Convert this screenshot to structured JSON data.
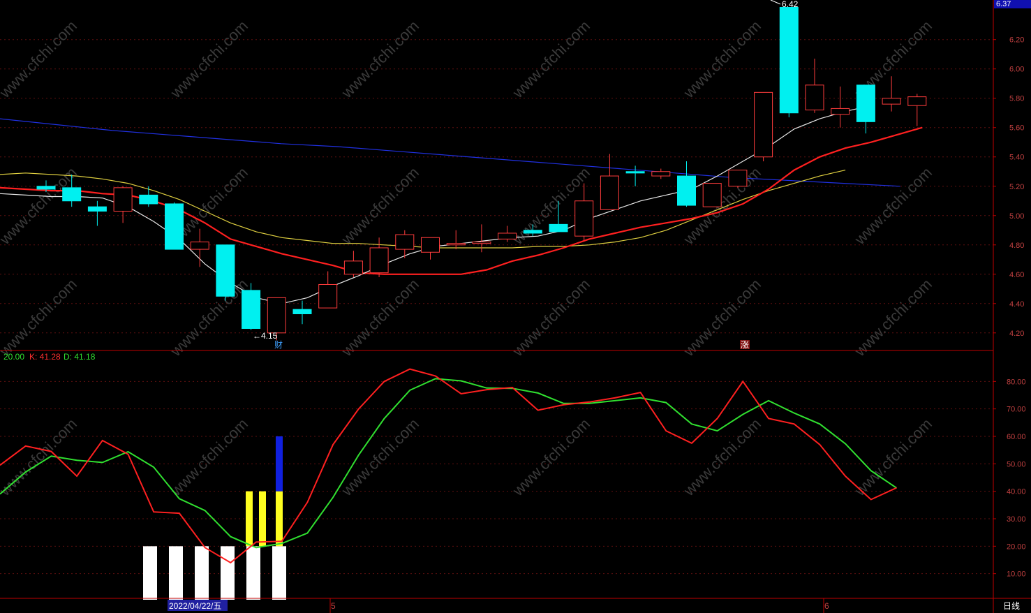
{
  "colors": {
    "background": "#000000",
    "up": "#ff3c3c",
    "down": "#00f0f0",
    "ma5": "#e8e8e8",
    "ma10": "#ff2020",
    "ma20": "#e0d040",
    "ma60": "#2030e0",
    "k_line": "#ff2020",
    "d_line": "#30e030",
    "axis": "#c00000"
  },
  "price_panel": {
    "top_label": "6.37",
    "y_ticks": [
      "6.20",
      "6.00",
      "5.80",
      "5.60",
      "5.40",
      "5.20",
      "5.00",
      "4.80",
      "4.60",
      "4.40",
      "4.20"
    ],
    "high_marker": "6.42",
    "low_marker": "←4.15",
    "event_markers": [
      "财",
      "涨"
    ]
  },
  "indicator_panel": {
    "header_prefix": "20.00",
    "k_label": "K: 41.28",
    "d_label": "D: 41.18",
    "y_ticks": [
      "80.00",
      "70.00",
      "60.00",
      "50.00",
      "40.00",
      "30.00",
      "20.00",
      "10.00"
    ]
  },
  "x_axis": {
    "date_label": "2022/04/22/五",
    "month_labels": [
      "5",
      "6"
    ],
    "period_label": "日线"
  },
  "watermark": "www.cfchi.com",
  "chart_data": {
    "type": "candlestick",
    "candles": [
      {
        "o": 5.2,
        "h": 5.24,
        "l": 5.16,
        "c": 5.18
      },
      {
        "o": 5.19,
        "h": 5.28,
        "l": 5.06,
        "c": 5.1
      },
      {
        "o": 5.06,
        "h": 5.1,
        "l": 4.93,
        "c": 5.03
      },
      {
        "o": 5.03,
        "h": 5.2,
        "l": 4.95,
        "c": 5.19
      },
      {
        "o": 5.14,
        "h": 5.2,
        "l": 5.06,
        "c": 5.08
      },
      {
        "o": 5.08,
        "h": 5.09,
        "l": 4.77,
        "c": 4.77
      },
      {
        "o": 4.77,
        "h": 4.91,
        "l": 4.65,
        "c": 4.82
      },
      {
        "o": 4.8,
        "h": 4.8,
        "l": 4.42,
        "c": 4.45
      },
      {
        "o": 4.49,
        "h": 4.54,
        "l": 4.22,
        "c": 4.23
      },
      {
        "o": 4.2,
        "h": 4.44,
        "l": 4.15,
        "c": 4.44
      },
      {
        "o": 4.36,
        "h": 4.42,
        "l": 4.26,
        "c": 4.33
      },
      {
        "o": 4.37,
        "h": 4.62,
        "l": 4.37,
        "c": 4.53
      },
      {
        "o": 4.6,
        "h": 4.76,
        "l": 4.58,
        "c": 4.69
      },
      {
        "o": 4.61,
        "h": 4.85,
        "l": 4.58,
        "c": 4.78
      },
      {
        "o": 4.77,
        "h": 4.9,
        "l": 4.71,
        "c": 4.87
      },
      {
        "o": 4.75,
        "h": 4.84,
        "l": 4.7,
        "c": 4.85
      },
      {
        "o": 4.8,
        "h": 4.9,
        "l": 4.77,
        "c": 4.81
      },
      {
        "o": 4.81,
        "h": 4.94,
        "l": 4.75,
        "c": 4.82
      },
      {
        "o": 4.84,
        "h": 4.93,
        "l": 4.82,
        "c": 4.88
      },
      {
        "o": 4.9,
        "h": 4.94,
        "l": 4.86,
        "c": 4.88
      },
      {
        "o": 4.94,
        "h": 5.1,
        "l": 4.92,
        "c": 4.89
      },
      {
        "o": 4.86,
        "h": 5.22,
        "l": 4.83,
        "c": 5.1
      },
      {
        "o": 5.04,
        "h": 5.42,
        "l": 5.04,
        "c": 5.27
      },
      {
        "o": 5.3,
        "h": 5.34,
        "l": 5.2,
        "c": 5.29
      },
      {
        "o": 5.27,
        "h": 5.32,
        "l": 5.25,
        "c": 5.3
      },
      {
        "o": 5.27,
        "h": 5.37,
        "l": 5.06,
        "c": 5.07
      },
      {
        "o": 5.06,
        "h": 5.22,
        "l": 5.06,
        "c": 5.22
      },
      {
        "o": 5.2,
        "h": 5.31,
        "l": 5.19,
        "c": 5.31
      },
      {
        "o": 5.4,
        "h": 5.83,
        "l": 5.37,
        "c": 5.84
      },
      {
        "o": 6.42,
        "h": 6.42,
        "l": 5.67,
        "c": 5.7
      },
      {
        "o": 5.72,
        "h": 6.07,
        "l": 5.7,
        "c": 5.89
      },
      {
        "o": 5.69,
        "h": 5.88,
        "l": 5.6,
        "c": 5.73
      },
      {
        "o": 5.89,
        "h": 5.89,
        "l": 5.56,
        "c": 5.64
      },
      {
        "o": 5.76,
        "h": 5.95,
        "l": 5.71,
        "c": 5.8
      },
      {
        "o": 5.75,
        "h": 5.83,
        "l": 5.61,
        "c": 5.81
      }
    ],
    "ma5": [
      5.15,
      5.14,
      5.13,
      5.13,
      5.12,
      5.06,
      4.96,
      4.84,
      4.67,
      4.54,
      4.44,
      4.4,
      4.44,
      4.52,
      4.59,
      4.67,
      4.74,
      4.79,
      4.81,
      4.83,
      4.85,
      4.86,
      4.9,
      4.98,
      5.04,
      5.1,
      5.14,
      5.18,
      5.27,
      5.37,
      5.47,
      5.59,
      5.66,
      5.71,
      5.75
    ],
    "ma10": [
      5.19,
      5.18,
      5.17,
      5.17,
      5.15,
      5.14,
      5.1,
      5.04,
      4.95,
      4.84,
      4.79,
      4.74,
      4.7,
      4.66,
      4.61,
      4.6,
      4.6,
      4.6,
      4.6,
      4.63,
      4.69,
      4.73,
      4.78,
      4.84,
      4.88,
      4.92,
      4.95,
      4.98,
      5.02,
      5.08,
      5.18,
      5.31,
      5.4,
      5.46,
      5.5,
      5.55,
      5.6
    ],
    "ma20": [
      5.28,
      5.29,
      5.28,
      5.27,
      5.25,
      5.22,
      5.17,
      5.11,
      5.03,
      4.95,
      4.89,
      4.85,
      4.83,
      4.81,
      4.81,
      4.8,
      4.79,
      4.78,
      4.78,
      4.78,
      4.78,
      4.79,
      4.79,
      4.8,
      4.82,
      4.85,
      4.9,
      4.97,
      5.04,
      5.11,
      5.17,
      5.22,
      5.27,
      5.31
    ],
    "ma60": [
      5.66,
      5.62,
      5.58,
      5.55,
      5.52,
      5.49,
      5.47,
      5.44,
      5.41,
      5.38,
      5.35,
      5.32,
      5.29,
      5.26,
      5.24,
      5.22,
      5.2
    ],
    "kdj": {
      "k": [
        49.5,
        56.5,
        54.5,
        45.5,
        58.5,
        53.5,
        32.5,
        32.0,
        19.5,
        14.0,
        21.5,
        21.8,
        36.0,
        57.0,
        70.0,
        80.0,
        84.5,
        82.0,
        75.5,
        77.0,
        77.8,
        69.5,
        71.5,
        72.5,
        74.0,
        76.0,
        62.0,
        57.5,
        66.5,
        80.0,
        66.5,
        64.5,
        57.0,
        45.5,
        37.0,
        41.28
      ],
      "d": [
        39.0,
        47.0,
        52.8,
        51.3,
        50.5,
        54.4,
        48.8,
        37.3,
        33.0,
        23.5,
        19.5,
        21.0,
        24.8,
        37.8,
        53.2,
        66.5,
        76.8,
        81.0,
        80.2,
        77.6,
        77.5,
        75.8,
        72.0,
        72.0,
        73.0,
        74.0,
        72.3,
        64.5,
        62.0,
        68.0,
        73.0,
        68.5,
        64.5,
        57.3,
        47.5,
        41.18
      ],
      "bars": [
        {
          "idx": 5,
          "white": 20
        },
        {
          "idx": 6,
          "white": 20
        },
        {
          "idx": 7,
          "white": 20,
          "yellow": 40
        },
        {
          "idx": 8,
          "white": 20,
          "yellow": 40,
          "blue": 60
        },
        {
          "idx": 9,
          "white": 20
        },
        {
          "idx": 10,
          "white": 20,
          "yellow": 40
        }
      ]
    },
    "price_range": [
      4.08,
      6.47
    ],
    "kdj_range": [
      0,
      90
    ]
  }
}
